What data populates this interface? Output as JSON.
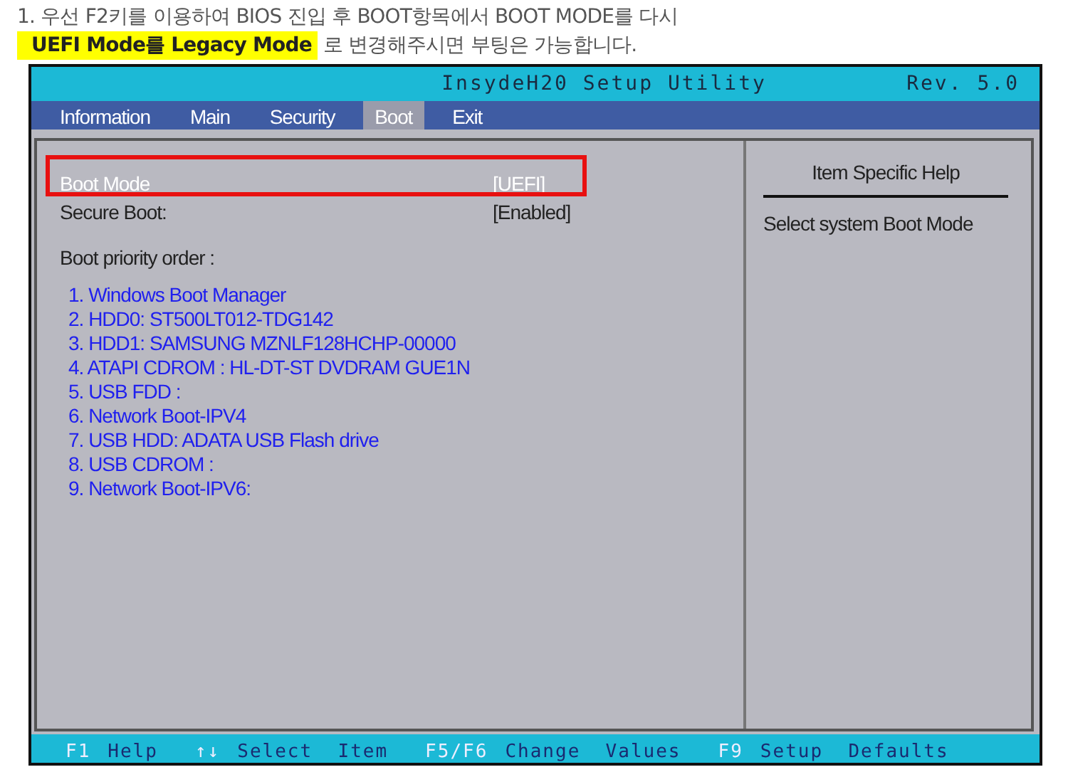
{
  "instruction": {
    "line_1": "1. 우선 F2키를 이용하여 BIOS 진입 후 BOOT항목에서 BOOT MODE를 다시",
    "highlight": "UEFI Mode를 Legacy Mode",
    "rest": "로 변경해주시면 부팅은 가능합니다."
  },
  "bios": {
    "title": "InsydeH20 Setup Utility",
    "revision": "Rev. 5.0",
    "tabs": [
      {
        "label": "Information",
        "selected": false
      },
      {
        "label": "Main",
        "selected": false
      },
      {
        "label": "Security",
        "selected": false
      },
      {
        "label": "Boot",
        "selected": true
      },
      {
        "label": "Exit",
        "selected": false
      }
    ],
    "settings": [
      {
        "label": "Boot Mode",
        "value": "[UEFI]",
        "selected": true,
        "highlighted": true
      },
      {
        "label": "Secure Boot:",
        "value": "[Enabled]",
        "selected": false,
        "highlighted": false
      }
    ],
    "priority_heading": "Boot priority order :",
    "boot_order": [
      "1. Windows Boot Manager",
      "2. HDD0: ST500LT012-TDG142",
      "3. HDD1: SAMSUNG MZNLF128HCHP-00000",
      "4. ATAPI CDROM : HL-DT-ST DVDRAM GUE1N",
      "5. USB FDD :",
      "6. Network Boot-IPV4",
      "7. USB HDD: ADATA USB Flash drive",
      "8. USB CDROM :",
      "9. Network Boot-IPV6:"
    ],
    "help_title": "Item Specific Help",
    "help_text": "Select system Boot Mode",
    "footer": [
      {
        "key": "F1",
        "action": "Help"
      },
      {
        "key": "↑↓",
        "action": "Select  Item"
      },
      {
        "key": "F5/F6",
        "action": "Change  Values"
      },
      {
        "key": "F9",
        "action": "Setup  Defaults"
      }
    ]
  }
}
